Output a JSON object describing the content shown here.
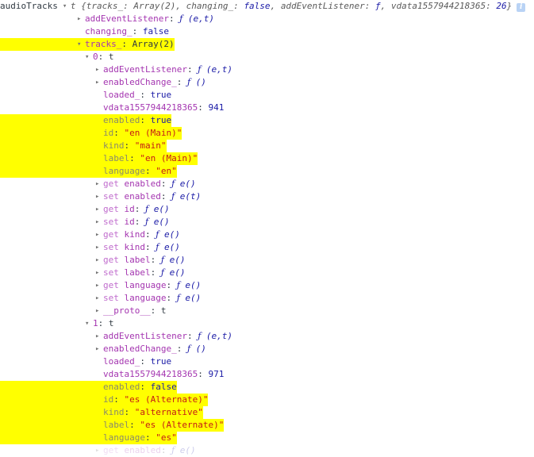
{
  "console": {
    "root_name": "audioTracks",
    "info_icon": "info-icon",
    "info_glyph": "i",
    "colors": {
      "property": "#a435b0",
      "accessor": "#c06ccd",
      "greyed_property": "#8a8a6a",
      "string": "#c41a16",
      "number_boolean": "#1a1aa6",
      "highlight": "#ffff00",
      "text": "#303942",
      "info_badge": "#b9d3f5"
    },
    "summary": {
      "ctor": "t",
      "open_brace": "{",
      "close_brace": "}",
      "entries": [
        {
          "key": "tracks_",
          "value": "Array(2)",
          "value_kind": "preview"
        },
        {
          "key": "changing_",
          "value": "false",
          "value_kind": "boolean"
        },
        {
          "key": "addEventListener",
          "value": "f",
          "value_kind": "function"
        },
        {
          "key": "vdata1557944218365",
          "value": "26",
          "value_kind": "number"
        }
      ]
    },
    "rows": [
      {
        "indent": 1,
        "tri": "closed",
        "key": "addEventListener",
        "key_kind": "prop",
        "value": "ƒ (e,t)",
        "value_kind": "function",
        "highlight": false
      },
      {
        "indent": 1,
        "tri": "none",
        "key": "changing_",
        "key_kind": "prop",
        "value": "false",
        "value_kind": "boolean",
        "highlight": false
      },
      {
        "indent": 1,
        "tri": "open",
        "key": "tracks_",
        "key_kind": "prop",
        "value": "Array(2)",
        "value_kind": "ctor",
        "highlight": true
      },
      {
        "indent": 2,
        "tri": "open",
        "key": "0",
        "key_kind": "index",
        "value": "t",
        "value_kind": "ctor",
        "highlight": false
      },
      {
        "indent": 3,
        "tri": "closed",
        "key": "addEventListener",
        "key_kind": "prop",
        "value": "ƒ (e,t)",
        "value_kind": "function",
        "highlight": false
      },
      {
        "indent": 3,
        "tri": "closed",
        "key": "enabledChange_",
        "key_kind": "prop",
        "value": "ƒ ()",
        "value_kind": "function",
        "highlight": false
      },
      {
        "indent": 3,
        "tri": "none",
        "key": "loaded_",
        "key_kind": "prop",
        "value": "true",
        "value_kind": "boolean",
        "highlight": false
      },
      {
        "indent": 3,
        "tri": "none",
        "key": "vdata1557944218365",
        "key_kind": "prop",
        "value": "941",
        "value_kind": "number",
        "highlight": false
      },
      {
        "indent": 3,
        "tri": "none",
        "key": "enabled",
        "key_kind": "grey",
        "value": "true",
        "value_kind": "boolean",
        "highlight": true
      },
      {
        "indent": 3,
        "tri": "none",
        "key": "id",
        "key_kind": "grey",
        "value": "\"en (Main)\"",
        "value_kind": "string",
        "highlight": true
      },
      {
        "indent": 3,
        "tri": "none",
        "key": "kind",
        "key_kind": "grey",
        "value": "\"main\"",
        "value_kind": "string",
        "highlight": true
      },
      {
        "indent": 3,
        "tri": "none",
        "key": "label",
        "key_kind": "grey",
        "value": "\"en (Main)\"",
        "value_kind": "string",
        "highlight": true
      },
      {
        "indent": 3,
        "tri": "none",
        "key": "language",
        "key_kind": "grey",
        "value": "\"en\"",
        "value_kind": "string",
        "highlight": true
      },
      {
        "indent": 3,
        "tri": "closed",
        "accessor": "get",
        "key": "enabled",
        "key_kind": "prop",
        "value": "ƒ e()",
        "value_kind": "function",
        "highlight": false
      },
      {
        "indent": 3,
        "tri": "closed",
        "accessor": "set",
        "key": "enabled",
        "key_kind": "prop",
        "value": "ƒ e(t)",
        "value_kind": "function",
        "highlight": false
      },
      {
        "indent": 3,
        "tri": "closed",
        "accessor": "get",
        "key": "id",
        "key_kind": "prop",
        "value": "ƒ e()",
        "value_kind": "function",
        "highlight": false
      },
      {
        "indent": 3,
        "tri": "closed",
        "accessor": "set",
        "key": "id",
        "key_kind": "prop",
        "value": "ƒ e()",
        "value_kind": "function",
        "highlight": false
      },
      {
        "indent": 3,
        "tri": "closed",
        "accessor": "get",
        "key": "kind",
        "key_kind": "prop",
        "value": "ƒ e()",
        "value_kind": "function",
        "highlight": false
      },
      {
        "indent": 3,
        "tri": "closed",
        "accessor": "set",
        "key": "kind",
        "key_kind": "prop",
        "value": "ƒ e()",
        "value_kind": "function",
        "highlight": false
      },
      {
        "indent": 3,
        "tri": "closed",
        "accessor": "get",
        "key": "label",
        "key_kind": "prop",
        "value": "ƒ e()",
        "value_kind": "function",
        "highlight": false
      },
      {
        "indent": 3,
        "tri": "closed",
        "accessor": "set",
        "key": "label",
        "key_kind": "prop",
        "value": "ƒ e()",
        "value_kind": "function",
        "highlight": false
      },
      {
        "indent": 3,
        "tri": "closed",
        "accessor": "get",
        "key": "language",
        "key_kind": "prop",
        "value": "ƒ e()",
        "value_kind": "function",
        "highlight": false
      },
      {
        "indent": 3,
        "tri": "closed",
        "accessor": "set",
        "key": "language",
        "key_kind": "prop",
        "value": "ƒ e()",
        "value_kind": "function",
        "highlight": false
      },
      {
        "indent": 3,
        "tri": "closed",
        "key": "__proto__",
        "key_kind": "prop",
        "value": "t",
        "value_kind": "ctor",
        "highlight": false
      },
      {
        "indent": 2,
        "tri": "open",
        "key": "1",
        "key_kind": "index",
        "value": "t",
        "value_kind": "ctor",
        "highlight": false
      },
      {
        "indent": 3,
        "tri": "closed",
        "key": "addEventListener",
        "key_kind": "prop",
        "value": "ƒ (e,t)",
        "value_kind": "function",
        "highlight": false
      },
      {
        "indent": 3,
        "tri": "closed",
        "key": "enabledChange_",
        "key_kind": "prop",
        "value": "ƒ ()",
        "value_kind": "function",
        "highlight": false
      },
      {
        "indent": 3,
        "tri": "none",
        "key": "loaded_",
        "key_kind": "prop",
        "value": "true",
        "value_kind": "boolean",
        "highlight": false
      },
      {
        "indent": 3,
        "tri": "none",
        "key": "vdata1557944218365",
        "key_kind": "prop",
        "value": "971",
        "value_kind": "number",
        "highlight": false
      },
      {
        "indent": 3,
        "tri": "none",
        "key": "enabled",
        "key_kind": "grey",
        "value": "false",
        "value_kind": "boolean",
        "highlight": true
      },
      {
        "indent": 3,
        "tri": "none",
        "key": "id",
        "key_kind": "grey",
        "value": "\"es (Alternate)\"",
        "value_kind": "string",
        "highlight": true
      },
      {
        "indent": 3,
        "tri": "none",
        "key": "kind",
        "key_kind": "grey",
        "value": "\"alternative\"",
        "value_kind": "string",
        "highlight": true
      },
      {
        "indent": 3,
        "tri": "none",
        "key": "label",
        "key_kind": "grey",
        "value": "\"es (Alternate)\"",
        "value_kind": "string",
        "highlight": true
      },
      {
        "indent": 3,
        "tri": "none",
        "key": "language",
        "key_kind": "grey",
        "value": "\"es\"",
        "value_kind": "string",
        "highlight": true
      },
      {
        "indent": 3,
        "tri": "closed",
        "accessor": "get",
        "key": "enabled",
        "key_kind": "prop",
        "value": "ƒ e()",
        "value_kind": "function",
        "highlight": false,
        "cutoff": true
      }
    ]
  }
}
